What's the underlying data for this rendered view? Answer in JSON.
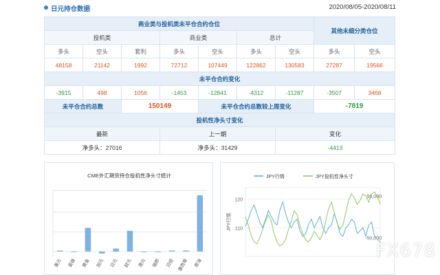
{
  "header": {
    "title": "日元持仓数据",
    "date_range": "2020/08/05-2020/08/11"
  },
  "table": {
    "group1_title": "商业类与投机类未平仓合约仓位",
    "other_title": "其他未细分类仓位",
    "spec_label": "投机类",
    "comm_label": "商业类",
    "total_label": "总计",
    "col_long": "多头",
    "col_short": "空头",
    "col_spread": "套利",
    "positions": [
      "48158",
      "21142",
      "1992",
      "72712",
      "107449",
      "122862",
      "130583",
      "27287",
      "19566"
    ],
    "change_title": "未平仓合约变化",
    "changes": [
      "-3915",
      "498",
      "1056",
      "-1453",
      "-12841",
      "-4312",
      "-11287",
      "-3507",
      "3468"
    ],
    "oi_total_label": "未平仓合约总数",
    "oi_total_value": "150149",
    "oi_change_label": "未平仓合约总数较上周变化",
    "oi_change_value": "-7819",
    "net_title": "投机性净头寸变化",
    "latest_label": "最新",
    "prev_label": "上一期",
    "change_label": "变化",
    "latest_value": "净多头：27016",
    "prev_value": "净多头：31429",
    "net_change_value": "-4413"
  },
  "chart_data": [
    {
      "type": "bar",
      "title": "CME外汇期货持仓投机性净头寸统计",
      "categories": [
        "美元",
        "英镑",
        "黄金",
        "加元",
        "日元",
        "欧元",
        "澳元",
        "瑞郎",
        "日经",
        "墨西哥",
        "原油"
      ],
      "values": [
        1,
        0,
        24,
        -2,
        3,
        21,
        0,
        0,
        1,
        1,
        57
      ],
      "ylim": [
        -5,
        62
      ],
      "grid": true,
      "color": "#7fb2e0"
    },
    {
      "type": "line",
      "series": [
        {
          "name": "JPY行情",
          "color": "#5aaee0",
          "axis": "left",
          "values": [
            110.5,
            113,
            116,
            118,
            115,
            112,
            110,
            113,
            116,
            114,
            112,
            111,
            116,
            119,
            115,
            112,
            110,
            112,
            113,
            109,
            107,
            108,
            111,
            113,
            110,
            112,
            114,
            110,
            108,
            110,
            111,
            115,
            112,
            108,
            107,
            110,
            111,
            113,
            112,
            108,
            109,
            110,
            107,
            111,
            112,
            107,
            106,
            105
          ]
        },
        {
          "name": "JPY投机性净头寸",
          "color": "#8cc860",
          "axis": "right",
          "values": [
            0,
            -20000,
            -45000,
            -60000,
            -65000,
            -50000,
            -30000,
            -10000,
            5000,
            -10000,
            -40000,
            -60000,
            -70000,
            -65000,
            -55000,
            -30000,
            -10000,
            15000,
            5000,
            -20000,
            -40000,
            -55000,
            -60000,
            -50000,
            -35000,
            -45000,
            -55000,
            -40000,
            -10000,
            20000,
            35000,
            10000,
            -15000,
            -30000,
            -20000,
            10000,
            40000,
            55000,
            45000,
            30000,
            40000,
            55000,
            50000,
            35000,
            55000,
            60000,
            50000,
            30000
          ]
        }
      ],
      "yticks_left": [
        "120",
        "110"
      ],
      "ylabel_left": "JPY行情",
      "yticks_right": [
        "50,000",
        "-50,000"
      ],
      "left_range": [
        100,
        124
      ],
      "right_range": [
        -95000,
        70000
      ]
    }
  ],
  "watermark": "FX678"
}
